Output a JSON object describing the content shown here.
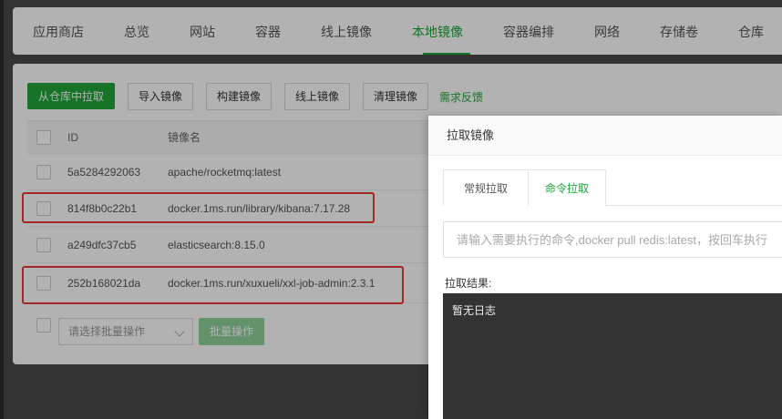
{
  "nav": {
    "tabs": [
      {
        "label": "应用商店"
      },
      {
        "label": "总览"
      },
      {
        "label": "网站"
      },
      {
        "label": "容器"
      },
      {
        "label": "线上镜像"
      },
      {
        "label": "本地镜像"
      },
      {
        "label": "容器编排"
      },
      {
        "label": "网络"
      },
      {
        "label": "存储卷"
      },
      {
        "label": "仓库"
      }
    ],
    "active_tab": "本地镜像"
  },
  "toolbar": {
    "pull_label": "从仓库中拉取",
    "import_label": "导入镜像",
    "build_label": "构建镜像",
    "online_label": "线上镜像",
    "clean_label": "清理镜像",
    "feedback_label": "需求反馈"
  },
  "table": {
    "columns": {
      "id": "ID",
      "name": "镜像名"
    },
    "rows": [
      {
        "id": "5a5284292063",
        "name": "apache/rocketmq:latest",
        "highlighted": false
      },
      {
        "id": "814f8b0c22b1",
        "name": "docker.1ms.run/library/kibana:7.17.28",
        "highlighted": true
      },
      {
        "id": "a249dfc37cb5",
        "name": "elasticsearch:8.15.0",
        "highlighted": false
      },
      {
        "id": "252b168021da",
        "name": "docker.1ms.run/xuxueli/xxl-job-admin:2.3.1",
        "highlighted": true
      }
    ]
  },
  "batch": {
    "select_placeholder": "请选择批量操作",
    "button_label": "批量操作"
  },
  "modal": {
    "title": "拉取镜像",
    "tabs": [
      {
        "label": "常规拉取"
      },
      {
        "label": "命令拉取"
      }
    ],
    "active_tab": "命令拉取",
    "input_placeholder": "请输入需要执行的命令,docker pull redis:latest，按回车执行",
    "result_label": "拉取结果:",
    "log_text": "暂无日志"
  },
  "colors": {
    "accent": "#20a53a",
    "highlight_border": "#e53935",
    "log_bg": "#333333"
  }
}
